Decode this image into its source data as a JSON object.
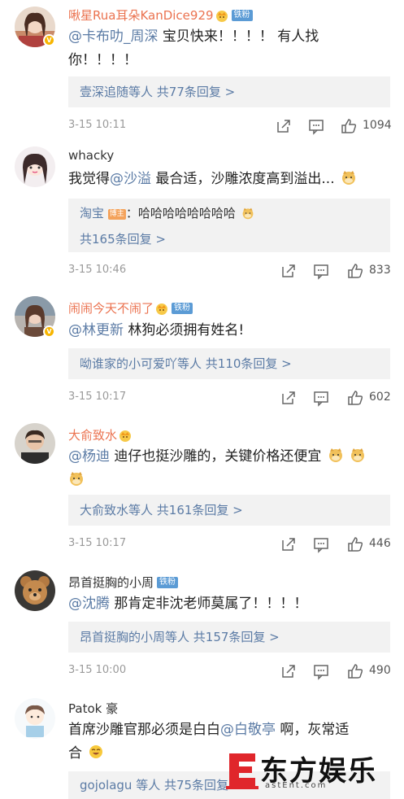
{
  "comments": [
    {
      "username": "啾星Rua耳朵KanDice929",
      "fan_badge": "铁粉",
      "mention": "@卡布叻_周深",
      "text_line1": " 宝贝快来！！！！ 有人找",
      "text_line2": "你！！！！",
      "reply_summary_name": "壹深追随等人",
      "reply_summary_count": " 共77条回复 >",
      "time": "3-15 10:11",
      "likes": "1094"
    },
    {
      "username": "whacky",
      "text_prefix": "我觉得",
      "mention": "@沙溢",
      "text_suffix": " 最合适，沙雕浓度高到溢出...",
      "reply_user": "淘宝",
      "host_badge": "博主",
      "reply_text": "：哈哈哈哈哈哈哈哈",
      "reply_count": "共165条回复 >",
      "time": "3-15 10:46",
      "likes": "833"
    },
    {
      "username": "闹闹今天不闹了",
      "fan_badge": "铁粉",
      "mention": "@林更新",
      "text": " 林狗必须拥有姓名!",
      "reply_summary_name": "呦谁家的小可爱吖等人",
      "reply_summary_count": " 共110条回复 >",
      "time": "3-15 10:17",
      "likes": "602"
    },
    {
      "username": "大俞致水",
      "mention": "@杨迪",
      "text": " 迪仔也挺沙雕的，关键价格还便宜",
      "reply_summary_name": "大俞致水等人",
      "reply_summary_count": " 共161条回复 >",
      "time": "3-15 10:17",
      "likes": "446"
    },
    {
      "username": "昂首挺胸的小周",
      "fan_badge": "铁粉",
      "mention": "@沈腾",
      "text": " 那肯定非沈老师莫属了！！！！",
      "reply_summary_name": "昂首挺胸的小周等人",
      "reply_summary_count": " 共157条回复 >",
      "time": "3-15 10:00",
      "likes": "490"
    },
    {
      "username": "Patok 豪",
      "text_prefix": "首席沙雕官那必须是白白",
      "mention": "@白敬亭",
      "text_suffix": " 啊，灰常适",
      "text_line2": "合",
      "reply_summary_name": "gojolagu",
      "reply_summary_count": " 等人 共75条回复 >"
    }
  ],
  "watermark": {
    "logo_text": "东方娱乐",
    "url_text": "astEnt.com"
  },
  "icons": [
    "share-icon",
    "comment-icon",
    "like-icon",
    "crown-icon",
    "doge-emoji"
  ],
  "colors": {
    "username_orange": "#eb7350",
    "mention_blue": "#5b7ba5",
    "reply_bg": "#f2f2f2",
    "meta_gray": "#9a9a9a",
    "logo_red": "#e0262b"
  }
}
